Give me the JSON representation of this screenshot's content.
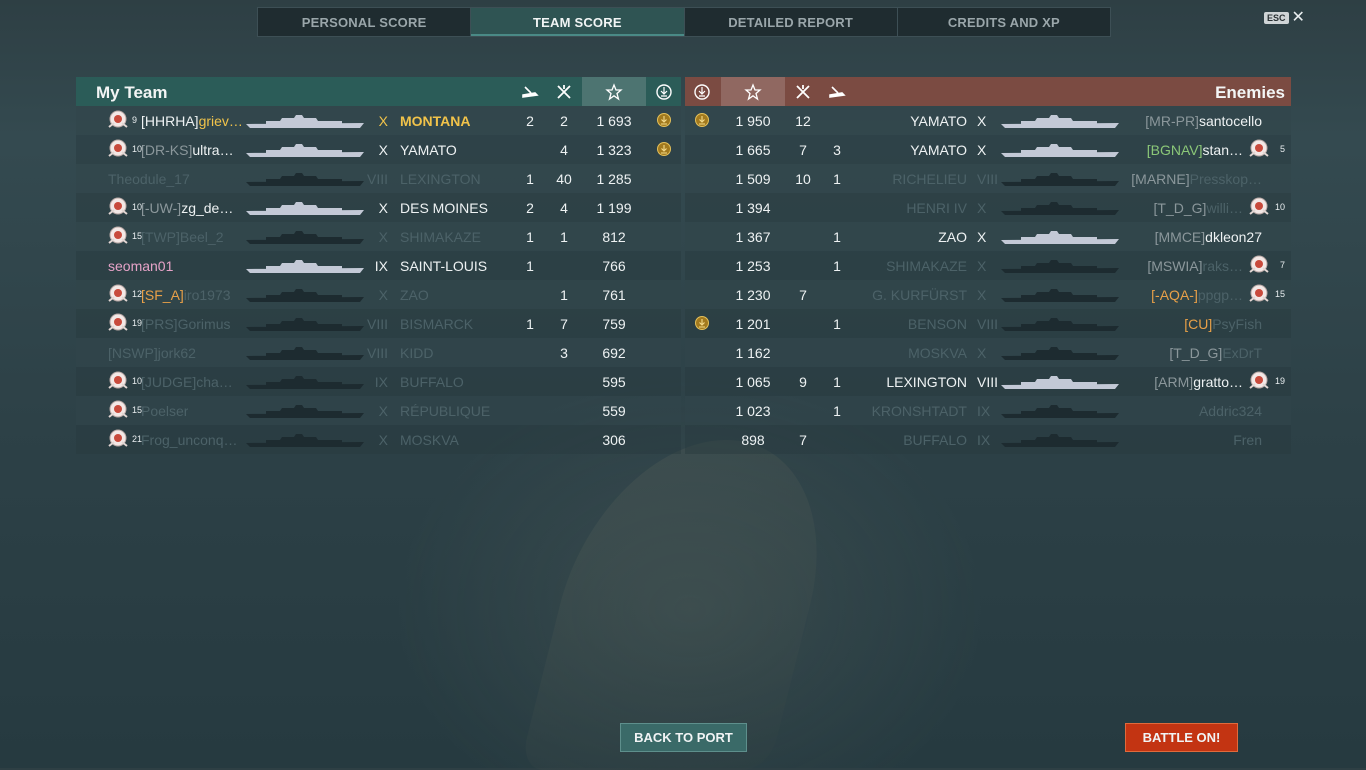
{
  "tabs": [
    {
      "label": "PERSONAL SCORE"
    },
    {
      "label": "TEAM SCORE"
    },
    {
      "label": "DETAILED REPORT"
    },
    {
      "label": "CREDITS AND XP"
    }
  ],
  "esc_key": "ESC",
  "close_glyph": "✕",
  "my_team": {
    "title": "My Team",
    "rows": [
      {
        "level": "9",
        "clan": "[HHRHA]",
        "name": "griev…",
        "tier": "X",
        "ship": "MONTANA",
        "kills": "2",
        "caps": "2",
        "xp": "1 693",
        "medal": true,
        "style": "self"
      },
      {
        "level": "10",
        "clan": "[DR-KS]",
        "name": "ultra…",
        "tier": "X",
        "ship": "YAMATO",
        "kills": "",
        "caps": "4",
        "xp": "1 323",
        "medal": true,
        "style": "alive"
      },
      {
        "level": "",
        "clan": "",
        "name": "Theodule_17",
        "tier": "VIII",
        "ship": "LEXINGTON",
        "kills": "1",
        "caps": "40",
        "xp": "1 285",
        "medal": false,
        "style": "dead"
      },
      {
        "level": "10",
        "clan": "[-UW-]",
        "name": "zg_de…",
        "tier": "X",
        "ship": "DES MOINES",
        "kills": "2",
        "caps": "4",
        "xp": "1 199",
        "medal": false,
        "style": "alive"
      },
      {
        "level": "15",
        "clan": "[TWP]",
        "name": "Beel_2",
        "tier": "X",
        "ship": "SHIMAKAZE",
        "kills": "1",
        "caps": "1",
        "xp": "812",
        "medal": false,
        "style": "dead"
      },
      {
        "level": "",
        "clan": "",
        "name": "seoman01",
        "tier": "IX",
        "ship": "SAINT-LOUIS",
        "kills": "1",
        "caps": "",
        "xp": "766",
        "medal": false,
        "style": "pink"
      },
      {
        "level": "12",
        "clan": "[SF_A]",
        "name": "iro1973",
        "tier": "X",
        "ship": "ZAO",
        "kills": "",
        "caps": "1",
        "xp": "761",
        "medal": false,
        "style": "dead-orange"
      },
      {
        "level": "19",
        "clan": "[PRS]",
        "name": "Gorimus",
        "tier": "VIII",
        "ship": "BISMARCK",
        "kills": "1",
        "caps": "7",
        "xp": "759",
        "medal": false,
        "style": "dead"
      },
      {
        "level": "",
        "clan": "[NSWP]",
        "name": "jork62",
        "tier": "VIII",
        "ship": "KIDD",
        "kills": "",
        "caps": "3",
        "xp": "692",
        "medal": false,
        "style": "dead"
      },
      {
        "level": "10",
        "clan": "[JUDGE]",
        "name": "cha…",
        "tier": "IX",
        "ship": "BUFFALO",
        "kills": "",
        "caps": "",
        "xp": "595",
        "medal": false,
        "style": "dead"
      },
      {
        "level": "15",
        "clan": "",
        "name": "Poelser",
        "tier": "X",
        "ship": "RÉPUBLIQUE",
        "kills": "",
        "caps": "",
        "xp": "559",
        "medal": false,
        "style": "dead"
      },
      {
        "level": "21",
        "clan": "",
        "name": "Frog_unconq…",
        "tier": "X",
        "ship": "MOSKVA",
        "kills": "",
        "caps": "",
        "xp": "306",
        "medal": false,
        "style": "dead"
      }
    ]
  },
  "enemies": {
    "title": "Enemies",
    "rows": [
      {
        "medal": true,
        "xp": "1 950",
        "caps": "12",
        "kills": "",
        "ship": "YAMATO",
        "tier": "X",
        "clan": "[MR-PR]",
        "name": "santocello",
        "level": "",
        "style": "alive"
      },
      {
        "medal": false,
        "xp": "1 665",
        "caps": "7",
        "kills": "3",
        "ship": "YAMATO",
        "tier": "X",
        "clan": "[BGNAV]",
        "name": "stan…",
        "level": "5",
        "style": "alive-green"
      },
      {
        "medal": false,
        "xp": "1 509",
        "caps": "10",
        "kills": "1",
        "ship": "RICHELIEU",
        "tier": "VIII",
        "clan": "[MARNE]",
        "name": "Presskop…",
        "level": "",
        "style": "dead"
      },
      {
        "medal": false,
        "xp": "1 394",
        "caps": "",
        "kills": "",
        "ship": "HENRI IV",
        "tier": "X",
        "clan": "[T_D_G]",
        "name": "willi…",
        "level": "10",
        "style": "dead"
      },
      {
        "medal": false,
        "xp": "1 367",
        "caps": "",
        "kills": "1",
        "ship": "ZAO",
        "tier": "X",
        "clan": "[MMCE]",
        "name": "dkleon27",
        "level": "",
        "style": "alive"
      },
      {
        "medal": false,
        "xp": "1 253",
        "caps": "",
        "kills": "1",
        "ship": "SHIMAKAZE",
        "tier": "X",
        "clan": "[MSWIA]",
        "name": "raks…",
        "level": "7",
        "style": "dead"
      },
      {
        "medal": false,
        "xp": "1 230",
        "caps": "7",
        "kills": "",
        "ship": "G. KURFÜRST",
        "tier": "X",
        "clan": "[-AQA-]",
        "name": "ppgp…",
        "level": "15",
        "style": "dead-orange"
      },
      {
        "medal": true,
        "xp": "1 201",
        "caps": "",
        "kills": "1",
        "ship": "BENSON",
        "tier": "VIII",
        "clan": "[CU]",
        "name": "PsyFish",
        "level": "",
        "style": "dead-orange"
      },
      {
        "medal": false,
        "xp": "1 162",
        "caps": "",
        "kills": "",
        "ship": "MOSKVA",
        "tier": "X",
        "clan": "[T_D_G]",
        "name": "ExDrT",
        "level": "",
        "style": "dead"
      },
      {
        "medal": false,
        "xp": "1 065",
        "caps": "9",
        "kills": "1",
        "ship": "LEXINGTON",
        "tier": "VIII",
        "clan": "[ARM]",
        "name": "gratto…",
        "level": "19",
        "style": "alive"
      },
      {
        "medal": false,
        "xp": "1 023",
        "caps": "",
        "kills": "1",
        "ship": "KRONSHTADT",
        "tier": "IX",
        "clan": "",
        "name": "Addric324",
        "level": "",
        "style": "dead"
      },
      {
        "medal": false,
        "xp": "898",
        "caps": "7",
        "kills": "",
        "ship": "BUFFALO",
        "tier": "IX",
        "clan": "",
        "name": "Fren",
        "level": "",
        "style": "dead"
      }
    ]
  },
  "buttons": {
    "back_to_port": "BACK TO PORT",
    "battle_on": "BATTLE ON!"
  }
}
